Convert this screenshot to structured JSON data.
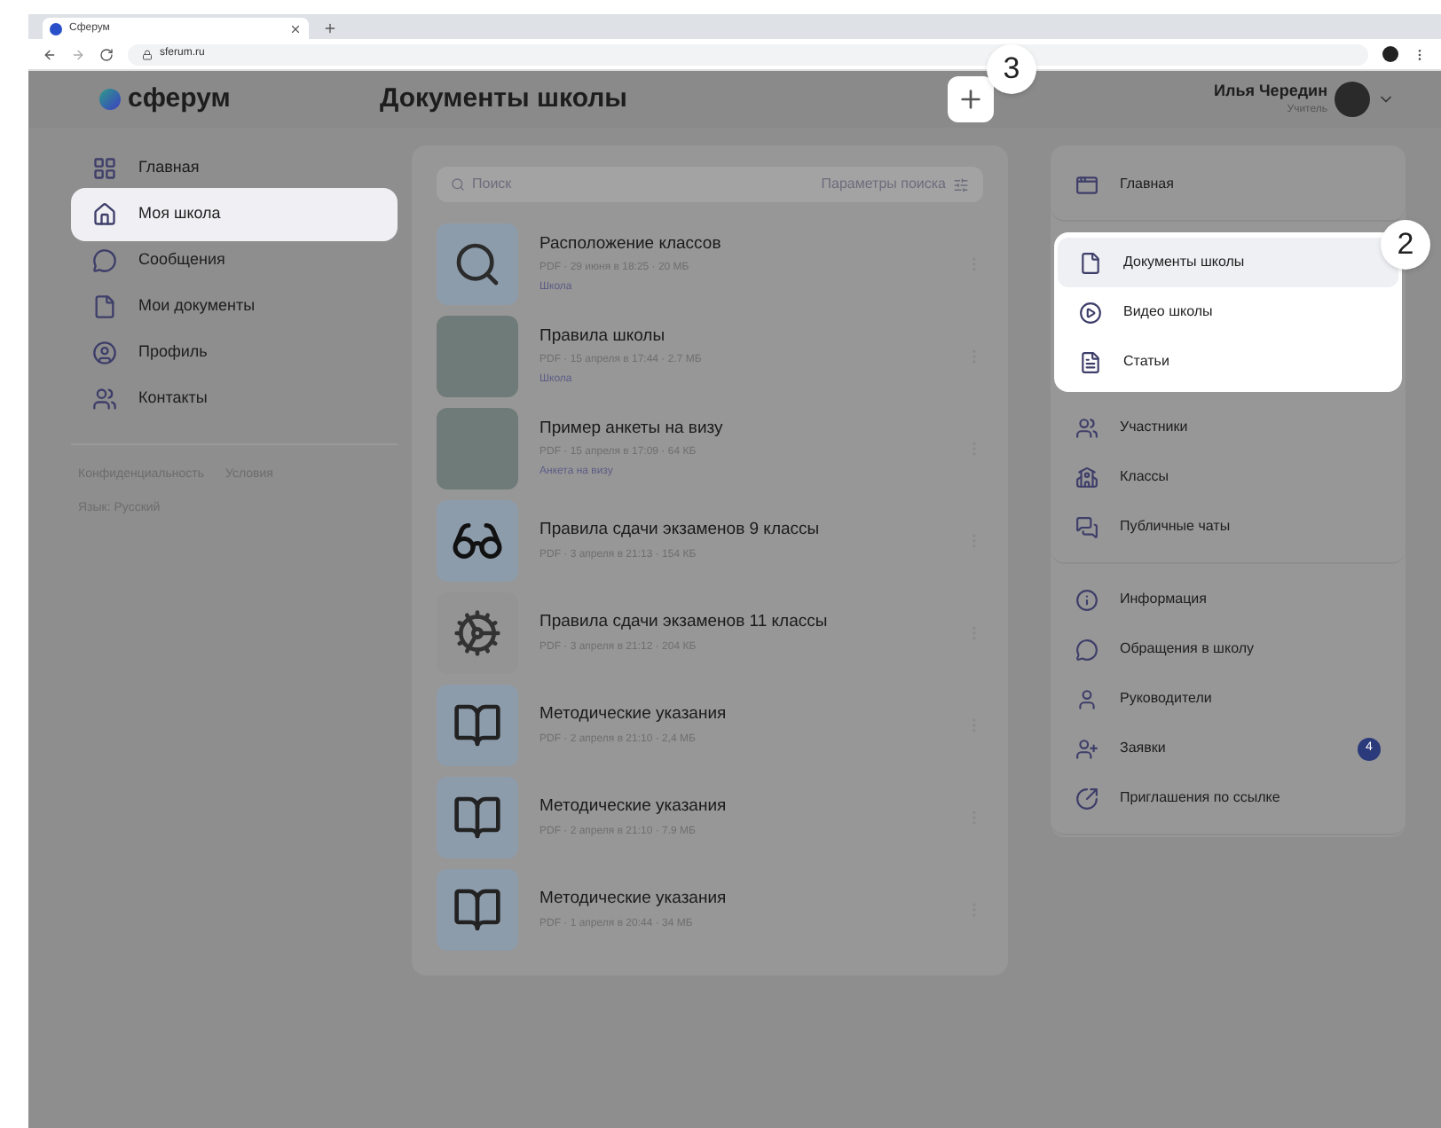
{
  "browser": {
    "tab_title": "Сферум",
    "url": "sferum.ru"
  },
  "header": {
    "logo": "сферум",
    "title": "Документы школы",
    "callout": "3",
    "user_name": "Илья Чередин",
    "user_role": "Учитель"
  },
  "sidebar": {
    "items": [
      {
        "label": "Главная",
        "selected": false
      },
      {
        "label": "Моя школа",
        "selected": true
      },
      {
        "label": "Сообщения",
        "selected": false
      },
      {
        "label": "Мои документы",
        "selected": false
      },
      {
        "label": "Профиль",
        "selected": false
      },
      {
        "label": "Контакты",
        "selected": false
      }
    ],
    "footer_links": [
      "Конфиденциальность",
      "Условия"
    ],
    "language": "Язык: Русский"
  },
  "documents": {
    "search_placeholder": "Поиск",
    "search_params": "Параметры поиска",
    "items": [
      {
        "kind": "magnifier",
        "title": "Расположение классов",
        "meta": "PDF · 29 июня в 18:25 · 20 МБ",
        "tag": "Школа"
      },
      {
        "kind": "photo",
        "title": "Правила школы",
        "meta": "PDF · 15 апреля в 17:44 · 2.7 МБ",
        "tag": "Школа"
      },
      {
        "kind": "photo",
        "title": "Пример анкеты на визу",
        "meta": "PDF · 15 апреля в 17:09 · 64 КБ",
        "tag": "Анкета на визу"
      },
      {
        "kind": "glasses",
        "title": "Правила сдачи экзаменов 9 классы",
        "meta": "PDF · 3 апреля в 21:13 · 154 КБ"
      },
      {
        "kind": "gear",
        "title": "Правила сдачи экзаменов 11 классы",
        "meta": "PDF · 3 апреля в 21:12 · 204 КБ"
      },
      {
        "kind": "book",
        "title": "Методические указания",
        "meta": "PDF · 2 апреля в 21:10 · 2,4 МБ"
      },
      {
        "kind": "book",
        "title": "Методические указания",
        "meta": "PDF · 2 апреля в 21:10 · 7.9 МБ"
      },
      {
        "kind": "book",
        "title": "Методические указания",
        "meta": "PDF · 1 апреля в 20:44 · 34 МБ"
      }
    ]
  },
  "school_menu": {
    "callout": "2",
    "groups": [
      {
        "highlighted": false,
        "items": [
          {
            "label": "Главная",
            "selected": false
          }
        ]
      },
      {
        "highlighted": true,
        "items": [
          {
            "label": "Документы школы",
            "selected": true
          },
          {
            "label": "Видео школы",
            "selected": false
          },
          {
            "label": "Статьи",
            "selected": false
          }
        ]
      },
      {
        "highlighted": false,
        "items": [
          {
            "label": "Участники",
            "selected": false
          },
          {
            "label": "Классы",
            "selected": false
          },
          {
            "label": "Публичные чаты",
            "selected": false
          }
        ]
      },
      {
        "highlighted": false,
        "items": [
          {
            "label": "Информация",
            "selected": false
          },
          {
            "label": "Обращения в школу",
            "selected": false
          },
          {
            "label": "Руководители",
            "selected": false
          },
          {
            "label": "Заявки",
            "selected": false,
            "badge": "4"
          },
          {
            "label": "Приглашения по ссылке",
            "selected": false
          }
        ]
      }
    ]
  }
}
